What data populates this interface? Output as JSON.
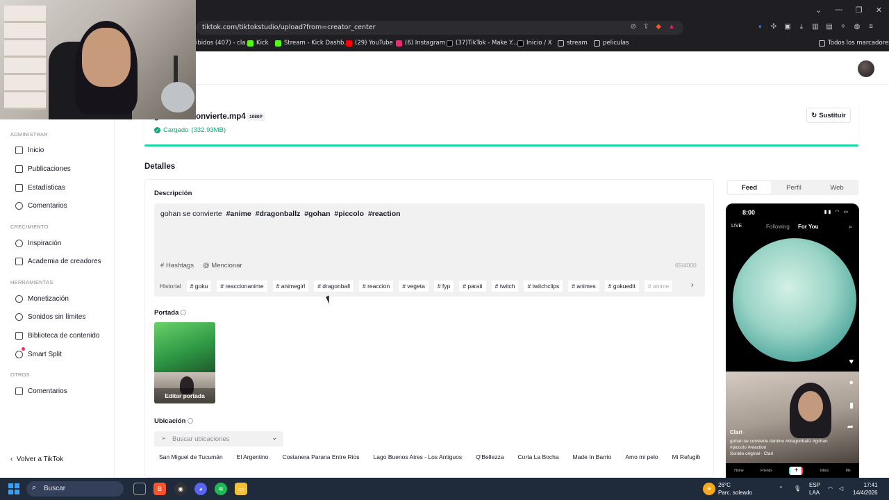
{
  "browser": {
    "url": "tiktok.com/tiktokstudio/upload?from=creator_center",
    "bookmarks": [
      "ibidos (407) - cla...",
      "Kick",
      "Stream - Kick Dashb...",
      "(29) YouTube",
      "(6) Instagram",
      "(37)TikTok - Make Y...",
      "Inicio / X",
      "stream",
      "peliculas",
      "Todos los marcadores"
    ]
  },
  "sidebar": {
    "sections": {
      "admin": "ADMINISTRAR",
      "growth": "CRECIMIENTO",
      "tools": "HERRAMIENTAS",
      "others": "OTROS"
    },
    "items": [
      "Inicio",
      "Publicaciones",
      "Estadísticas",
      "Comentarios",
      "Inspiración",
      "Academia de creadores",
      "Monetización",
      "Sonidos sin límites",
      "Biblioteca de contenido",
      "Smart Split",
      "Comentarios"
    ],
    "back": "Volver a TikTok"
  },
  "upload": {
    "file_name": "gohan se convierte.mp4",
    "resolution": "1080P",
    "status": "Cargado",
    "size": "(332.93MB)",
    "replace": "Sustituir",
    "progress": 1.0
  },
  "details": {
    "title": "Detalles",
    "description_label": "Descripción",
    "description_plain": "gohan se convierte",
    "description_tags": [
      "#anime",
      "#dragonballz",
      "#gohan",
      "#piccolo",
      "#reaction"
    ],
    "hashtags_btn": "Hashtags",
    "mention_btn": "Mencionar",
    "counter": "65/4000",
    "history_label": "Historial",
    "history_tags": [
      "# goku",
      "# reaccionanime",
      "# animegirl",
      "# dragonball",
      "# reaccion",
      "# vegeta",
      "# fyp",
      "# parati",
      "# twitch",
      "# twitchclips",
      "# animes",
      "# gokuedit",
      "# anime"
    ],
    "cover_label": "Portada",
    "cover_edit": "Editar portada",
    "location_label": "Ubicación",
    "location_placeholder": "Buscar ubicaciones",
    "locations": [
      "San Miguel de Tucumán",
      "El Argentino",
      "Costanera Parana Entre Rios",
      "Lago Buenos Aires - Los Antiguos",
      "Q'Bellezza",
      "Corta La Bocha",
      "Made In Barrio",
      "Amo mi pelo",
      "Mi Refugio"
    ]
  },
  "preview": {
    "tabs": [
      "Feed",
      "Perfil",
      "Web"
    ],
    "active_tab": "Feed",
    "time": "8:00",
    "live": "LIVE",
    "following": "Following",
    "for_you": "For You",
    "username": "Clari",
    "caption": "gohan se convierte #anime #dragonballz #gohan #piccolo #reaction",
    "sound": "Sonido original - Clari",
    "nav": [
      "Home",
      "Friends",
      "+",
      "Inbox",
      "Me"
    ]
  },
  "taskbar": {
    "search": "Buscar",
    "temp": "26°C",
    "weather": "Parc. soleado",
    "lang1": "ESP",
    "lang2": "LAA",
    "time": "17:41",
    "date": "14/4/2026"
  }
}
